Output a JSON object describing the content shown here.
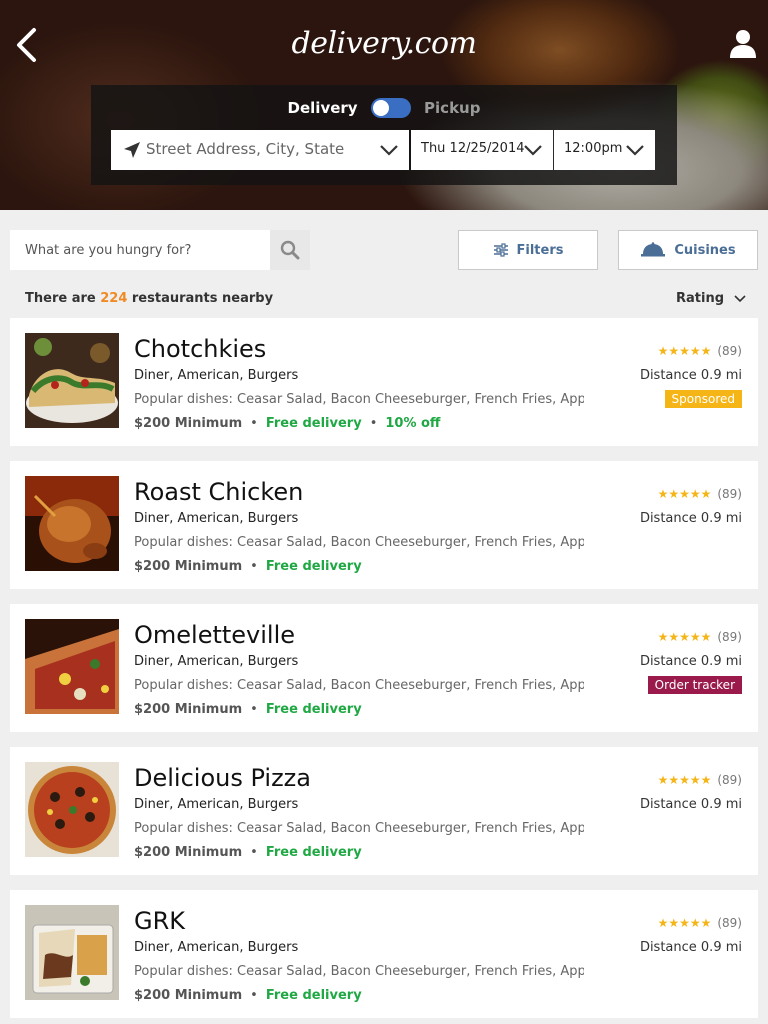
{
  "header": {
    "logo": "delivery.com",
    "mode": {
      "delivery_label": "Delivery",
      "pickup_label": "Pickup",
      "selected": "Delivery"
    },
    "address": {
      "placeholder": "Street Address, City, State"
    },
    "date": "Thu 12/25/2014",
    "time": "12:00pm"
  },
  "toolbar": {
    "search_placeholder": "What are you hungry for?",
    "filters_label": "Filters",
    "cuisines_label": "Cuisines"
  },
  "results": {
    "prefix": "There are ",
    "count": "224",
    "suffix": " restaurants nearby",
    "sort_label": "Rating"
  },
  "restaurants": [
    {
      "name": "Chotchkies",
      "cuisine": "Diner, American, Burgers",
      "dishes": "Popular dishes: Ceasar Salad, Bacon Cheeseburger, French Fries, Apple ...",
      "minimum": "$200 Minimum",
      "delivery": "Free delivery",
      "deal": "10% off",
      "stars": "★★★★★",
      "reviews": "(89)",
      "distance": "Distance 0.9 mi",
      "badge": "Sponsored",
      "badge_type": "sponsored",
      "image": "tacos"
    },
    {
      "name": "Roast Chicken",
      "cuisine": "Diner, American, Burgers",
      "dishes": "Popular dishes: Ceasar Salad, Bacon Cheeseburger, French Fries, Apple ...",
      "minimum": "$200 Minimum",
      "delivery": "Free delivery",
      "deal": "",
      "stars": "★★★★★",
      "reviews": "(89)",
      "distance": "Distance 0.9 mi",
      "badge": "",
      "badge_type": "",
      "image": "chicken"
    },
    {
      "name": "Omeletteville",
      "cuisine": "Diner, American, Burgers",
      "dishes": "Popular dishes: Ceasar Salad, Bacon Cheeseburger, French Fries, Apple ...",
      "minimum": "$200 Minimum",
      "delivery": "Free delivery",
      "deal": "",
      "stars": "★★★★★",
      "reviews": "(89)",
      "distance": "Distance 0.9 mi",
      "badge": "Order tracker",
      "badge_type": "tracker",
      "image": "pizza-slice"
    },
    {
      "name": "Delicious Pizza",
      "cuisine": "Diner, American, Burgers",
      "dishes": "Popular dishes: Ceasar Salad, Bacon Cheeseburger, French Fries, Apple ...",
      "minimum": "$200 Minimum",
      "delivery": "Free delivery",
      "deal": "",
      "stars": "★★★★★",
      "reviews": "(89)",
      "distance": "Distance 0.9 mi",
      "badge": "",
      "badge_type": "",
      "image": "pizza"
    },
    {
      "name": "GRK",
      "cuisine": "Diner, American, Burgers",
      "dishes": "Popular dishes: Ceasar Salad, Bacon Cheeseburger, French Fries, Apple ...",
      "minimum": "$200 Minimum",
      "delivery": "Free delivery",
      "deal": "",
      "stars": "★★★★★",
      "reviews": "(89)",
      "distance": "Distance 0.9 mi",
      "badge": "",
      "badge_type": "",
      "image": "gyro-box"
    }
  ],
  "colors": {
    "accent_blue": "#3a6ec2",
    "link_blue": "#4a6e96",
    "count_orange": "#f08a24",
    "free_green": "#1fa843",
    "star_gold": "#f5b517",
    "sponsored": "#f5b517",
    "tracker": "#9a1b4b"
  }
}
